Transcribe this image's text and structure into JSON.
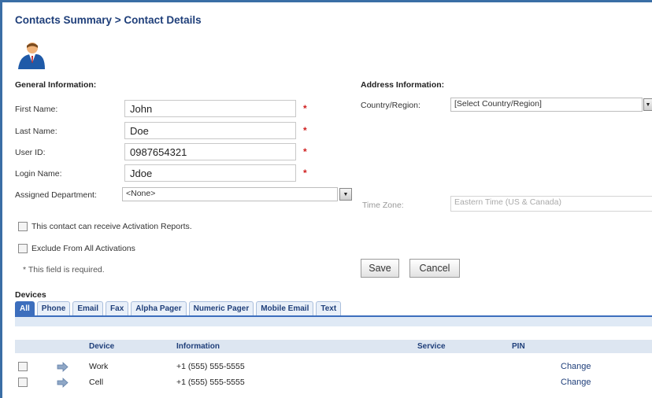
{
  "breadcrumb": "Contacts Summary > Contact Details",
  "general": {
    "title": "General Information:",
    "first_name_label": "First Name:",
    "first_name_value": "John",
    "last_name_label": "Last Name:",
    "last_name_value": "Doe",
    "user_id_label": "User ID:",
    "user_id_value": "0987654321",
    "login_label": "Login Name:",
    "login_value": "Jdoe",
    "dept_label": "Assigned Department:",
    "dept_value": "<None>",
    "required_mark": "*",
    "activation_reports_label": "This contact can receive Activation Reports.",
    "exclude_label": "Exclude From All Activations",
    "required_note": "* This field is required."
  },
  "address": {
    "title": "Address Information:",
    "country_label": "Country/Region:",
    "country_value": "[Select Country/Region]",
    "timezone_label": "Time Zone:",
    "timezone_value": "Eastern Time (US & Canada)"
  },
  "buttons": {
    "save": "Save",
    "cancel": "Cancel"
  },
  "devices": {
    "title": "Devices",
    "tabs": [
      "All",
      "Phone",
      "Email",
      "Fax",
      "Alpha Pager",
      "Numeric Pager",
      "Mobile Email",
      "Text"
    ],
    "columns": {
      "device": "Device",
      "information": "Information",
      "service": "Service",
      "pin": "PIN"
    },
    "rows": [
      {
        "device": "Work",
        "information": "+1 (555) 555-5555",
        "action": "Change"
      },
      {
        "device": "Cell",
        "information": "+1 (555) 555-5555",
        "action": "Change"
      }
    ]
  },
  "colors": {
    "accent": "#3c6ebd",
    "heading": "#1f3f7a",
    "required": "#d02020"
  }
}
